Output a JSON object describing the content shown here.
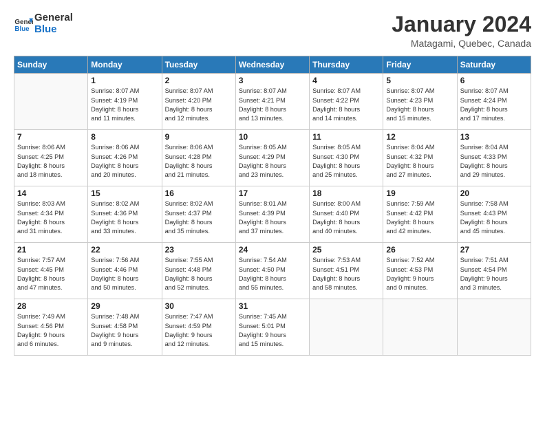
{
  "header": {
    "logo_line1": "General",
    "logo_line2": "Blue",
    "month": "January 2024",
    "location": "Matagami, Quebec, Canada"
  },
  "weekdays": [
    "Sunday",
    "Monday",
    "Tuesday",
    "Wednesday",
    "Thursday",
    "Friday",
    "Saturday"
  ],
  "weeks": [
    [
      {
        "day": "",
        "info": ""
      },
      {
        "day": "1",
        "info": "Sunrise: 8:07 AM\nSunset: 4:19 PM\nDaylight: 8 hours\nand 11 minutes."
      },
      {
        "day": "2",
        "info": "Sunrise: 8:07 AM\nSunset: 4:20 PM\nDaylight: 8 hours\nand 12 minutes."
      },
      {
        "day": "3",
        "info": "Sunrise: 8:07 AM\nSunset: 4:21 PM\nDaylight: 8 hours\nand 13 minutes."
      },
      {
        "day": "4",
        "info": "Sunrise: 8:07 AM\nSunset: 4:22 PM\nDaylight: 8 hours\nand 14 minutes."
      },
      {
        "day": "5",
        "info": "Sunrise: 8:07 AM\nSunset: 4:23 PM\nDaylight: 8 hours\nand 15 minutes."
      },
      {
        "day": "6",
        "info": "Sunrise: 8:07 AM\nSunset: 4:24 PM\nDaylight: 8 hours\nand 17 minutes."
      }
    ],
    [
      {
        "day": "7",
        "info": "Sunrise: 8:06 AM\nSunset: 4:25 PM\nDaylight: 8 hours\nand 18 minutes."
      },
      {
        "day": "8",
        "info": "Sunrise: 8:06 AM\nSunset: 4:26 PM\nDaylight: 8 hours\nand 20 minutes."
      },
      {
        "day": "9",
        "info": "Sunrise: 8:06 AM\nSunset: 4:28 PM\nDaylight: 8 hours\nand 21 minutes."
      },
      {
        "day": "10",
        "info": "Sunrise: 8:05 AM\nSunset: 4:29 PM\nDaylight: 8 hours\nand 23 minutes."
      },
      {
        "day": "11",
        "info": "Sunrise: 8:05 AM\nSunset: 4:30 PM\nDaylight: 8 hours\nand 25 minutes."
      },
      {
        "day": "12",
        "info": "Sunrise: 8:04 AM\nSunset: 4:32 PM\nDaylight: 8 hours\nand 27 minutes."
      },
      {
        "day": "13",
        "info": "Sunrise: 8:04 AM\nSunset: 4:33 PM\nDaylight: 8 hours\nand 29 minutes."
      }
    ],
    [
      {
        "day": "14",
        "info": "Sunrise: 8:03 AM\nSunset: 4:34 PM\nDaylight: 8 hours\nand 31 minutes."
      },
      {
        "day": "15",
        "info": "Sunrise: 8:02 AM\nSunset: 4:36 PM\nDaylight: 8 hours\nand 33 minutes."
      },
      {
        "day": "16",
        "info": "Sunrise: 8:02 AM\nSunset: 4:37 PM\nDaylight: 8 hours\nand 35 minutes."
      },
      {
        "day": "17",
        "info": "Sunrise: 8:01 AM\nSunset: 4:39 PM\nDaylight: 8 hours\nand 37 minutes."
      },
      {
        "day": "18",
        "info": "Sunrise: 8:00 AM\nSunset: 4:40 PM\nDaylight: 8 hours\nand 40 minutes."
      },
      {
        "day": "19",
        "info": "Sunrise: 7:59 AM\nSunset: 4:42 PM\nDaylight: 8 hours\nand 42 minutes."
      },
      {
        "day": "20",
        "info": "Sunrise: 7:58 AM\nSunset: 4:43 PM\nDaylight: 8 hours\nand 45 minutes."
      }
    ],
    [
      {
        "day": "21",
        "info": "Sunrise: 7:57 AM\nSunset: 4:45 PM\nDaylight: 8 hours\nand 47 minutes."
      },
      {
        "day": "22",
        "info": "Sunrise: 7:56 AM\nSunset: 4:46 PM\nDaylight: 8 hours\nand 50 minutes."
      },
      {
        "day": "23",
        "info": "Sunrise: 7:55 AM\nSunset: 4:48 PM\nDaylight: 8 hours\nand 52 minutes."
      },
      {
        "day": "24",
        "info": "Sunrise: 7:54 AM\nSunset: 4:50 PM\nDaylight: 8 hours\nand 55 minutes."
      },
      {
        "day": "25",
        "info": "Sunrise: 7:53 AM\nSunset: 4:51 PM\nDaylight: 8 hours\nand 58 minutes."
      },
      {
        "day": "26",
        "info": "Sunrise: 7:52 AM\nSunset: 4:53 PM\nDaylight: 9 hours\nand 0 minutes."
      },
      {
        "day": "27",
        "info": "Sunrise: 7:51 AM\nSunset: 4:54 PM\nDaylight: 9 hours\nand 3 minutes."
      }
    ],
    [
      {
        "day": "28",
        "info": "Sunrise: 7:49 AM\nSunset: 4:56 PM\nDaylight: 9 hours\nand 6 minutes."
      },
      {
        "day": "29",
        "info": "Sunrise: 7:48 AM\nSunset: 4:58 PM\nDaylight: 9 hours\nand 9 minutes."
      },
      {
        "day": "30",
        "info": "Sunrise: 7:47 AM\nSunset: 4:59 PM\nDaylight: 9 hours\nand 12 minutes."
      },
      {
        "day": "31",
        "info": "Sunrise: 7:45 AM\nSunset: 5:01 PM\nDaylight: 9 hours\nand 15 minutes."
      },
      {
        "day": "",
        "info": ""
      },
      {
        "day": "",
        "info": ""
      },
      {
        "day": "",
        "info": ""
      }
    ]
  ]
}
